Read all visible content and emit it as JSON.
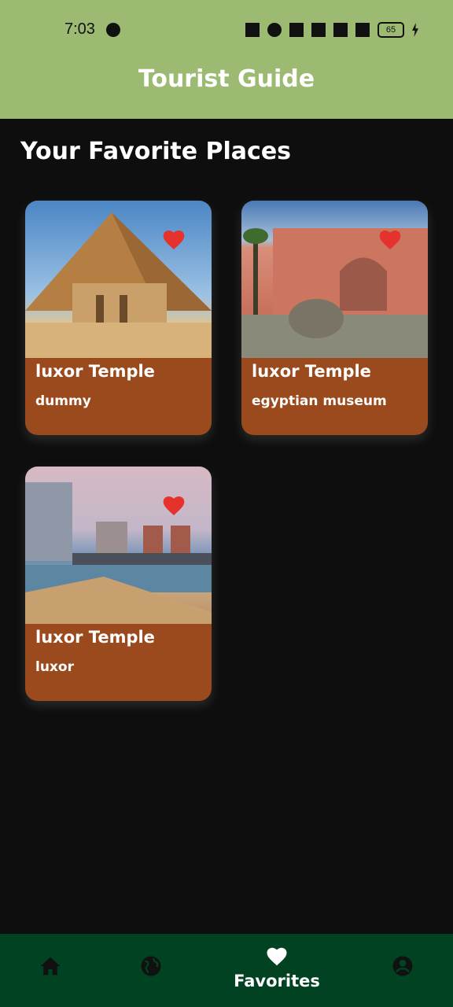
{
  "status_bar": {
    "time": "7:03",
    "battery": "65"
  },
  "app_bar": {
    "title": "Tourist Guide"
  },
  "section": {
    "title": "Your Favorite Places"
  },
  "cards": [
    {
      "title": "luxor Temple",
      "subtitle": "dummy"
    },
    {
      "title": "luxor Temple",
      "subtitle": "egyptian museum"
    },
    {
      "title": "luxor Temple",
      "subtitle": "luxor"
    }
  ],
  "bottom_nav": {
    "active_label": "Favorites",
    "items": [
      "home-icon",
      "globe-icon",
      "heart-icon",
      "account-icon"
    ]
  },
  "colors": {
    "app_bar": "#9dba73",
    "card": "#9b4a1e",
    "heart": "#e5322d",
    "bottom_nav": "#004221",
    "background": "#0e0e0e"
  }
}
